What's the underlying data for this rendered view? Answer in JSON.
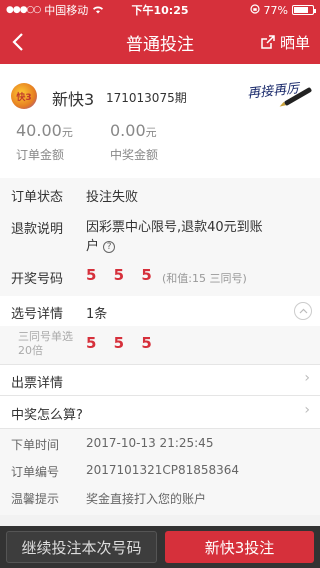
{
  "status_bar": {
    "carrier": "中国移动",
    "time": "下午10:25",
    "battery": "77%",
    "battery_level": 0.77
  },
  "nav": {
    "title": "普通投注",
    "share_label": "晒单"
  },
  "order": {
    "lottery_name": "新快3",
    "issue": "171013075期",
    "logo_text": "快3",
    "stamp_text": "再接再厉",
    "order_amount": "40.00",
    "order_amount_unit": "元",
    "order_amount_label": "订单金额",
    "prize_amount": "0.00",
    "prize_amount_unit": "元",
    "prize_amount_label": "中奖金额"
  },
  "details": {
    "status_label": "订单状态",
    "status_value": "投注失败",
    "refund_label": "退款说明",
    "refund_value_line1": "因彩票中心限号,退款40元到账",
    "refund_value_line2": "户",
    "draw_label": "开奖号码",
    "draw_numbers": "5 5 5",
    "draw_note": "(和值:15 三同号)",
    "selection_label": "选号详情",
    "selection_count": "1条",
    "selection_type": "三同号单选",
    "selection_multiple": "20倍",
    "selection_numbers": "5 5 5",
    "ticket_label": "出票详情",
    "howto_label": "中奖怎么算?",
    "order_time_label": "下单时间",
    "order_time_value": "2017-10-13 21:25:45",
    "order_no_label": "订单编号",
    "order_no_value": "2017101321CP81858364",
    "tip_label": "温馨提示",
    "tip_value": "奖金直接打入您的账户"
  },
  "bottom": {
    "continue_label": "继续投注本次号码",
    "bet_label": "新快3投注"
  }
}
